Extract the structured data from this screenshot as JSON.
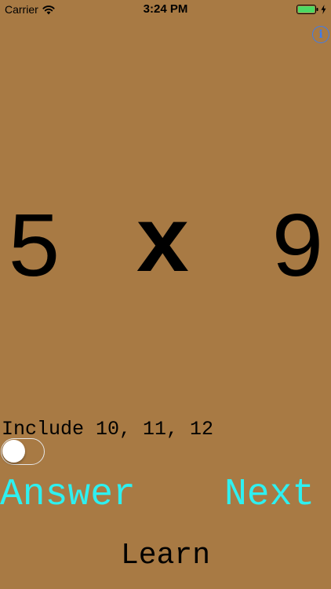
{
  "status_bar": {
    "carrier": "Carrier",
    "time": "3:24 PM",
    "icons": [
      "wifi-icon",
      "battery-icon",
      "charging-bolt-icon"
    ],
    "battery_color": "#4CD964"
  },
  "info_button": {
    "icon": "info-icon",
    "glyph": "i",
    "color": "#3C7CF0"
  },
  "problem": {
    "left_operand": "5",
    "operator": "x",
    "right_operand": "9"
  },
  "toggle": {
    "label": "Include 10, 11, 12",
    "state": "off"
  },
  "buttons": {
    "answer_label": "Answer",
    "next_label": "Next",
    "learn_label": "Learn",
    "accent_color": "#2EF0F0"
  },
  "background_color": "#A87A44"
}
